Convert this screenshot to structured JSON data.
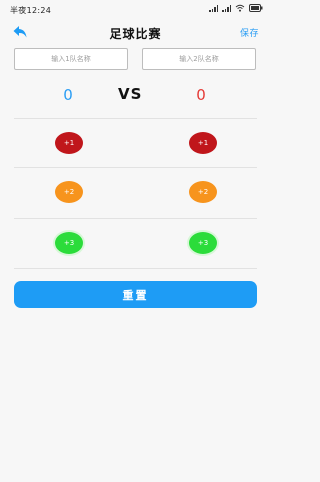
{
  "status_bar": {
    "time": "半夜12:24",
    "icons": [
      "signal-icon",
      "wifi-icon",
      "battery-icon"
    ]
  },
  "header": {
    "title": "足球比赛",
    "save_label": "保存",
    "back_icon": "back-arrow-icon"
  },
  "inputs": {
    "team1_placeholder": "输入1队名称",
    "team1_value": "",
    "team2_placeholder": "输入2队名称",
    "team2_value": ""
  },
  "scoreboard": {
    "team1_score": "0",
    "vs_label": "VS",
    "team2_score": "0"
  },
  "buttons": {
    "plus1": "+1",
    "plus2": "+2",
    "plus3": "+3",
    "reset_label": "重置"
  },
  "colors": {
    "accent": "#1e9cf5",
    "score_team1": "#2a9df4",
    "score_team2": "#e53935",
    "plus1": "#c0161b",
    "plus2": "#f7941d",
    "plus3": "#2bdc3a"
  }
}
